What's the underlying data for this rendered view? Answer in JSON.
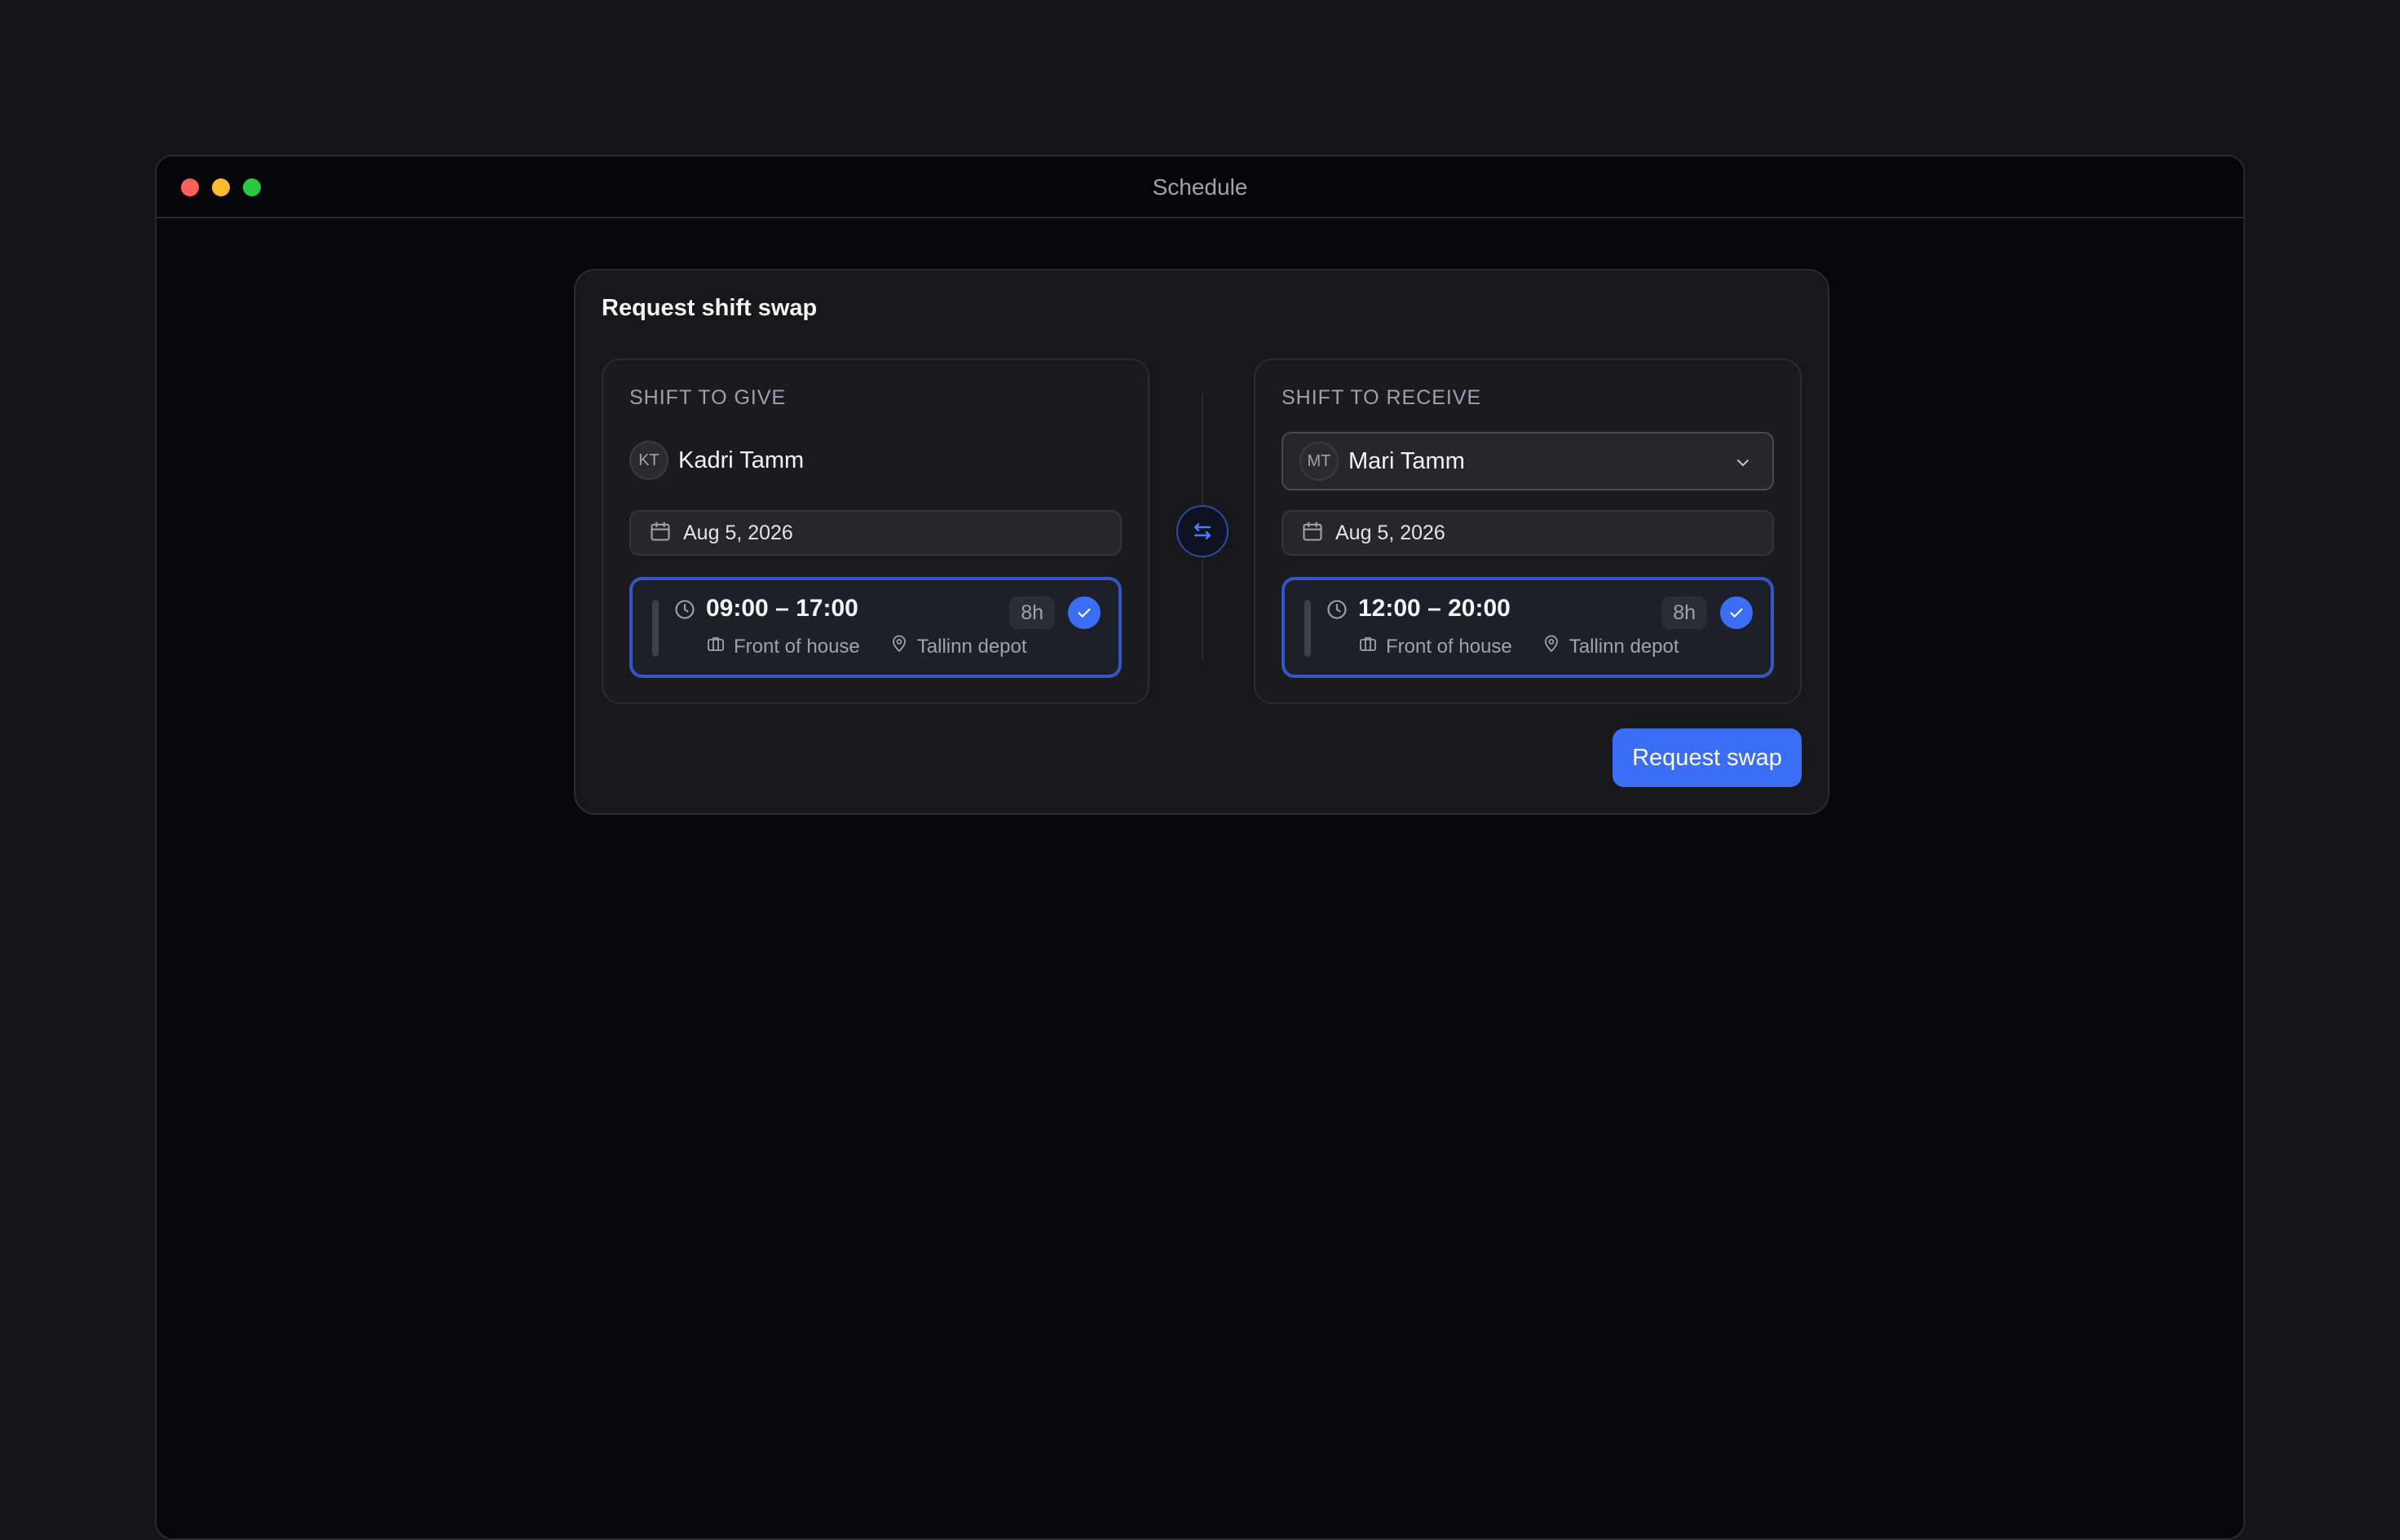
{
  "window": {
    "title": "Schedule"
  },
  "dialog": {
    "title": "Request shift swap",
    "give": {
      "label": "SHIFT TO GIVE",
      "person": {
        "initials": "KT",
        "name": "Kadri Tamm"
      },
      "date": "Aug 5, 2026",
      "shift": {
        "time": "09:00 – 17:00",
        "duration": "8h",
        "department": "Front of house",
        "location": "Tallinn depot",
        "selected": true
      }
    },
    "receive": {
      "label": "SHIFT TO RECEIVE",
      "person": {
        "initials": "MT",
        "name": "Mari Tamm"
      },
      "date": "Aug 5, 2026",
      "shift": {
        "time": "12:00 – 20:00",
        "duration": "8h",
        "department": "Front of house",
        "location": "Tallinn depot",
        "selected": true
      }
    },
    "submit_label": "Request swap"
  },
  "icons": {
    "swap": "swap-arrows-icon",
    "calendar": "calendar-icon",
    "clock": "clock-icon",
    "department": "briefcase-icon",
    "location": "map-pin-icon",
    "check": "check-icon",
    "dropdown": "chevron-down-icon"
  },
  "colors": {
    "accent": "#3b6ef6",
    "selected_border": "#3357c7",
    "close": "#ff5f57",
    "minimize": "#febc2e",
    "maximize": "#28c840"
  }
}
